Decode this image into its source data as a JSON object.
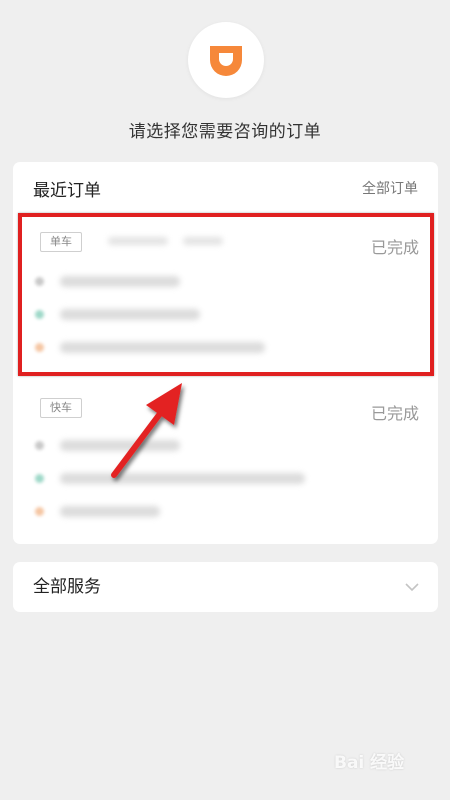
{
  "header": {
    "logo_icon": "didi-logo-icon",
    "prompt": "请选择您需要咨询的订单"
  },
  "recent_orders": {
    "title": "最近订单",
    "all_orders_link": "全部订单",
    "orders": [
      {
        "type": "单车",
        "status": "已完成"
      },
      {
        "type": "快车",
        "status": "已完成"
      }
    ]
  },
  "services": {
    "title": "全部服务",
    "chevron_icon": "chevron-down-icon"
  },
  "annotation": {
    "highlight_color": "#e02020",
    "arrow_icon": "red-arrow-icon"
  },
  "watermark": {
    "text": "Bai 经验",
    "icon": "baidu-paw-icon"
  },
  "colors": {
    "brand_orange": "#f6883a",
    "dot_gray": "#c9c9c9",
    "dot_teal": "#9ed8c8",
    "dot_orange": "#f5c6a3"
  }
}
